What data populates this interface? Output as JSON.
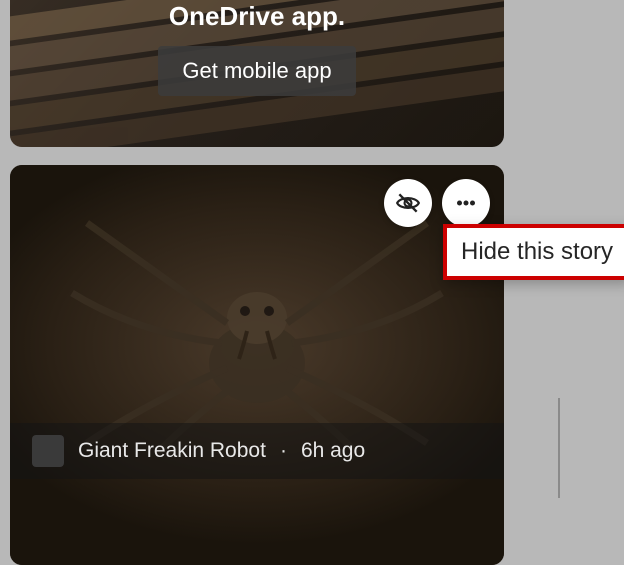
{
  "promo": {
    "title_line": "OneDrive app.",
    "button_label": "Get mobile app"
  },
  "news": {
    "source": "Giant Freakin Robot",
    "separator": "·",
    "age": "6h ago",
    "hide_icon": "hide-icon",
    "more_icon": "more-icon"
  },
  "tooltip": {
    "text": "Hide this story"
  }
}
